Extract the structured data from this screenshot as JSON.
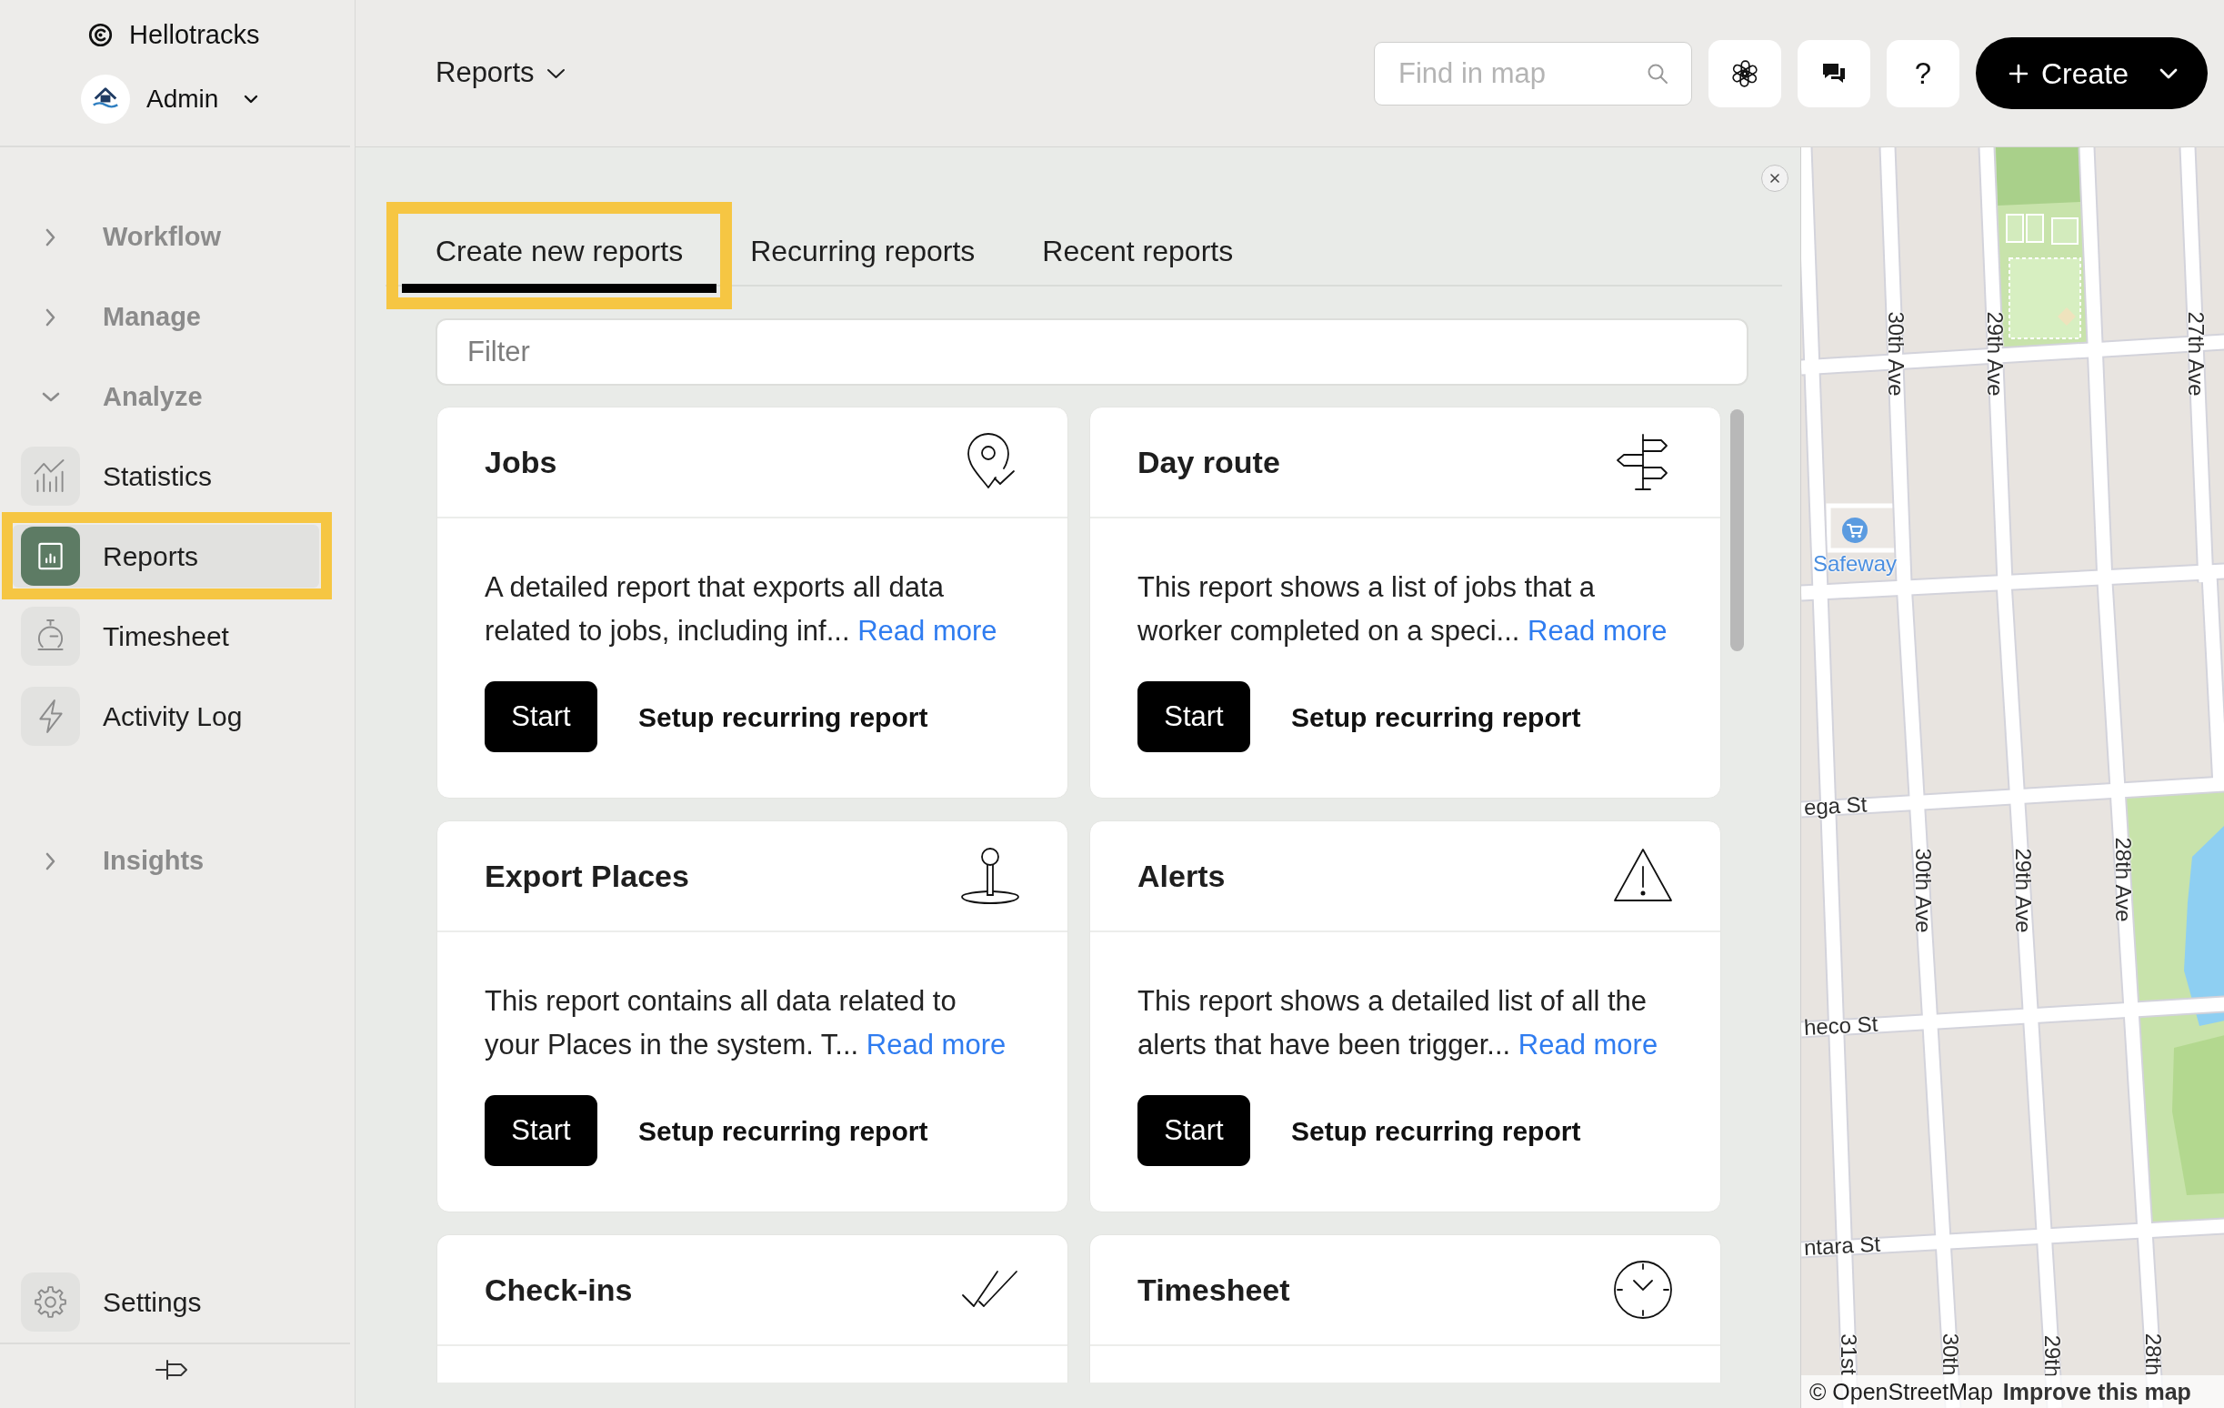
{
  "sidebar": {
    "brand": "Hellotracks",
    "account": "Admin",
    "sections": [
      {
        "label": "Workflow",
        "expanded": false
      },
      {
        "label": "Manage",
        "expanded": false
      },
      {
        "label": "Analyze",
        "expanded": true,
        "children": [
          {
            "label": "Statistics",
            "selected": false,
            "highlighted": false
          },
          {
            "label": "Reports",
            "selected": true,
            "highlighted": true
          },
          {
            "label": "Timesheet",
            "selected": false,
            "highlighted": false
          },
          {
            "label": "Activity Log",
            "selected": false,
            "highlighted": false
          }
        ]
      },
      {
        "label": "Insights",
        "expanded": false
      }
    ],
    "settings": "Settings"
  },
  "header": {
    "menu": "Reports",
    "search": {
      "placeholder": "Find in map"
    },
    "help": "?",
    "create": "Create"
  },
  "panel": {
    "tabs": [
      {
        "label": "Create new reports",
        "selected": true,
        "highlighted": true
      },
      {
        "label": "Recurring reports",
        "selected": false,
        "highlighted": false
      },
      {
        "label": "Recent reports",
        "selected": false,
        "highlighted": false
      }
    ],
    "filter": {
      "placeholder": "Filter"
    },
    "cards": [
      {
        "title": "Jobs",
        "description": "A detailed report that exports all data related to jobs, including inf...",
        "link": "Read more",
        "start": "Start",
        "setup": "Setup recurring report"
      },
      {
        "title": "Day route",
        "description": "This report shows a list of jobs that a worker completed on a speci...",
        "link": "Read more",
        "start": "Start",
        "setup": "Setup recurring report"
      },
      {
        "title": "Export Places",
        "description": "This report contains all data related to your Places in the system. T...",
        "link": "Read more",
        "start": "Start",
        "setup": "Setup recurring report"
      },
      {
        "title": "Alerts",
        "description": "This report shows a detailed list of all the alerts that have been trigger...",
        "link": "Read more",
        "start": "Start",
        "setup": "Setup recurring report"
      },
      {
        "title": "Check-ins"
      },
      {
        "title": "Timesheet"
      }
    ]
  },
  "map": {
    "labels": [
      {
        "text": "30th Ave",
        "kind": "street"
      },
      {
        "text": "29th Ave",
        "kind": "street"
      },
      {
        "text": "27th Ave",
        "kind": "street"
      },
      {
        "text": "Safeway",
        "kind": "poi"
      },
      {
        "text": "ega St",
        "kind": "street"
      },
      {
        "text": "30th Ave",
        "kind": "street"
      },
      {
        "text": "29th Ave",
        "kind": "street"
      },
      {
        "text": "28th Ave",
        "kind": "street"
      },
      {
        "text": "heco St",
        "kind": "street"
      },
      {
        "text": "ntara St",
        "kind": "street"
      },
      {
        "text": "31st",
        "kind": "street"
      },
      {
        "text": "30th",
        "kind": "street"
      },
      {
        "text": "29th",
        "kind": "street"
      },
      {
        "text": "28th",
        "kind": "street"
      }
    ],
    "attribution": "© OpenStreetMap",
    "link": "Improve this map"
  }
}
